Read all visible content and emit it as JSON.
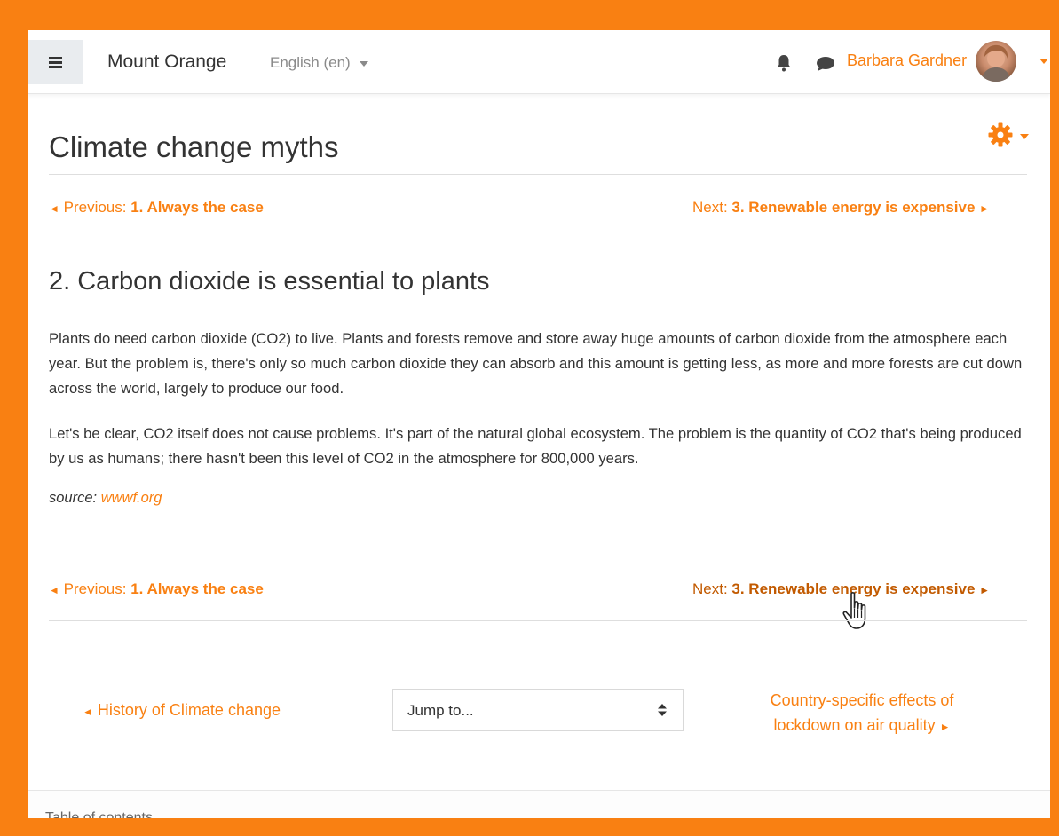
{
  "navbar": {
    "site_name": "Mount Orange",
    "language": "English (en)",
    "user_name": "Barbara Gardner"
  },
  "page": {
    "title": "Climate change myths",
    "prev_prefix": "Previous: ",
    "prev_link": "1. Always the case",
    "next_prefix": "Next: ",
    "next_link": "3. Renewable energy is expensive",
    "section_title": "2. Carbon dioxide is essential to plants",
    "para1": "Plants do need carbon dioxide (CO2) to live. Plants and forests remove and store away huge amounts of carbon dioxide from the atmosphere each year. But the problem is, there's only so much carbon dioxide they can absorb and this amount is getting less, as more and more forests are cut down across the world, largely to produce our food.",
    "para2": "Let's be clear, CO2 itself does not cause problems. It's part of the natural global ecosystem. The problem is the quantity of CO2 that's being produced by us as humans; there hasn't been this level of CO2 in the atmosphere for 800,000 years.",
    "source_label": "source: ",
    "source_link": "wwwf.org"
  },
  "activity_nav": {
    "prev_activity": "History of Climate change",
    "jump_placeholder": "Jump to...",
    "next_activity_line1": "Country-specific effects of",
    "next_activity_line2": "lockdown on air quality"
  },
  "footer": {
    "label": "Table of contents"
  },
  "colors": {
    "accent": "#f98012",
    "text": "#333333"
  },
  "icons": [
    "menu-icon",
    "bell-icon",
    "chat-icon",
    "gear-icon",
    "hand-cursor-icon",
    "sort-icon"
  ]
}
